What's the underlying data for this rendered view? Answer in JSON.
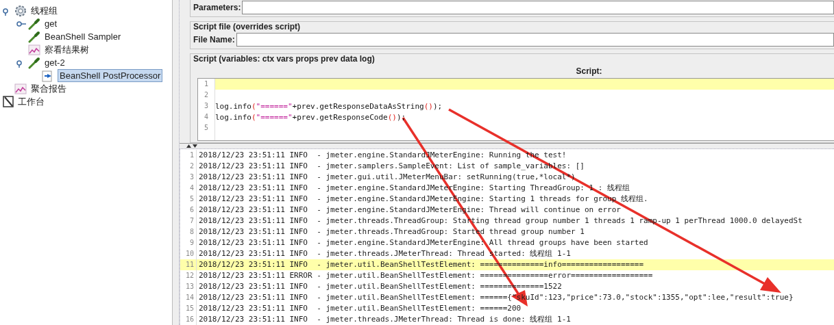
{
  "tree": [
    {
      "label": "线程组",
      "kind": "gear",
      "expanded": true,
      "selected": false,
      "children": [
        {
          "label": "get",
          "kind": "dropper",
          "expanded": false,
          "selected": false
        },
        {
          "label": "BeanShell Sampler",
          "kind": "dropper",
          "selected": false
        },
        {
          "label": "察看结果树",
          "kind": "chart",
          "selected": false
        },
        {
          "label": "get-2",
          "kind": "dropper",
          "expanded": true,
          "selected": false,
          "children": [
            {
              "label": "BeanShell PostProcessor",
              "kind": "processor",
              "selected": true
            }
          ]
        }
      ]
    },
    {
      "label": "聚合报告",
      "kind": "chart",
      "selected": false
    }
  ],
  "workbench": {
    "label": "工作台"
  },
  "parameters": {
    "label": "Parameters:"
  },
  "script_file": {
    "legend": "Script file (overrides script)",
    "label": "File Name:"
  },
  "script": {
    "legend": "Script (variables: ctx vars props prev data log)",
    "heading": "Script:",
    "lines": [
      {
        "number": "1",
        "highlighted": true
      },
      {
        "number": "2",
        "highlighted": false
      },
      {
        "number": "3",
        "highlighted": false,
        "tokens": [
          {
            "text": "log.info",
            "kind": "plain"
          },
          {
            "text": "(",
            "kind": "paren"
          },
          {
            "text": "\"======\"",
            "kind": "string"
          },
          {
            "text": "+prev.getResponseDataAsString",
            "kind": "plain"
          },
          {
            "text": "()",
            "kind": "paren"
          },
          {
            "text": ");",
            "kind": "plain"
          }
        ]
      },
      {
        "number": "4",
        "highlighted": false,
        "tokens": [
          {
            "text": "log.info",
            "kind": "plain"
          },
          {
            "text": "(",
            "kind": "paren"
          },
          {
            "text": "\"======\"",
            "kind": "string"
          },
          {
            "text": "+prev.getResponseCode",
            "kind": "plain"
          },
          {
            "text": "()",
            "kind": "paren"
          },
          {
            "text": ");",
            "kind": "plain"
          }
        ]
      },
      {
        "number": "5",
        "highlighted": false
      }
    ]
  },
  "log": [
    {
      "number": "1",
      "highlighted": false,
      "text": "2018/12/23 23:51:11 INFO  - jmeter.engine.StandardJMeterEngine: Running the test!"
    },
    {
      "number": "2",
      "highlighted": false,
      "text": "2018/12/23 23:51:11 INFO  - jmeter.samplers.SampleEvent: List of sample_variables: []"
    },
    {
      "number": "3",
      "highlighted": false,
      "text": "2018/12/23 23:51:11 INFO  - jmeter.gui.util.JMeterMenuBar: setRunning(true,*local*)"
    },
    {
      "number": "4",
      "highlighted": false,
      "text": "2018/12/23 23:51:11 INFO  - jmeter.engine.StandardJMeterEngine: Starting ThreadGroup: 1 : 线程组"
    },
    {
      "number": "5",
      "highlighted": false,
      "text": "2018/12/23 23:51:11 INFO  - jmeter.engine.StandardJMeterEngine: Starting 1 threads for group 线程组."
    },
    {
      "number": "6",
      "highlighted": false,
      "text": "2018/12/23 23:51:11 INFO  - jmeter.engine.StandardJMeterEngine: Thread will continue on error"
    },
    {
      "number": "7",
      "highlighted": false,
      "text": "2018/12/23 23:51:11 INFO  - jmeter.threads.ThreadGroup: Starting thread group number 1 threads 1 ramp-up 1 perThread 1000.0 delayedSt"
    },
    {
      "number": "8",
      "highlighted": false,
      "text": "2018/12/23 23:51:11 INFO  - jmeter.threads.ThreadGroup: Started thread group number 1"
    },
    {
      "number": "9",
      "highlighted": false,
      "text": "2018/12/23 23:51:11 INFO  - jmeter.engine.StandardJMeterEngine: All thread groups have been started"
    },
    {
      "number": "10",
      "highlighted": false,
      "text": "2018/12/23 23:51:11 INFO  - jmeter.threads.JMeterThread: Thread started: 线程组 1-1"
    },
    {
      "number": "11",
      "highlighted": true,
      "text": "2018/12/23 23:51:11 INFO  - jmeter.util.BeanShellTestElement: ==============info=================="
    },
    {
      "number": "12",
      "highlighted": false,
      "text": "2018/12/23 23:51:11 ERROR - jmeter.util.BeanShellTestElement: ===============error=================="
    },
    {
      "number": "13",
      "highlighted": false,
      "text": "2018/12/23 23:51:11 INFO  - jmeter.util.BeanShellTestElement: ==============1522"
    },
    {
      "number": "14",
      "highlighted": false,
      "text": "2018/12/23 23:51:11 INFO  - jmeter.util.BeanShellTestElement: ======{\"skuId\":123,\"price\":73.0,\"stock\":1355,\"opt\":lee,\"result\":true}"
    },
    {
      "number": "15",
      "highlighted": false,
      "text": "2018/12/23 23:51:11 INFO  - jmeter.util.BeanShellTestElement: ======200"
    },
    {
      "number": "16",
      "highlighted": false,
      "text": "2018/12/23 23:51:11 INFO  - jmeter.threads.JMeterThread: Thread is done: 线程组 1-1"
    }
  ]
}
